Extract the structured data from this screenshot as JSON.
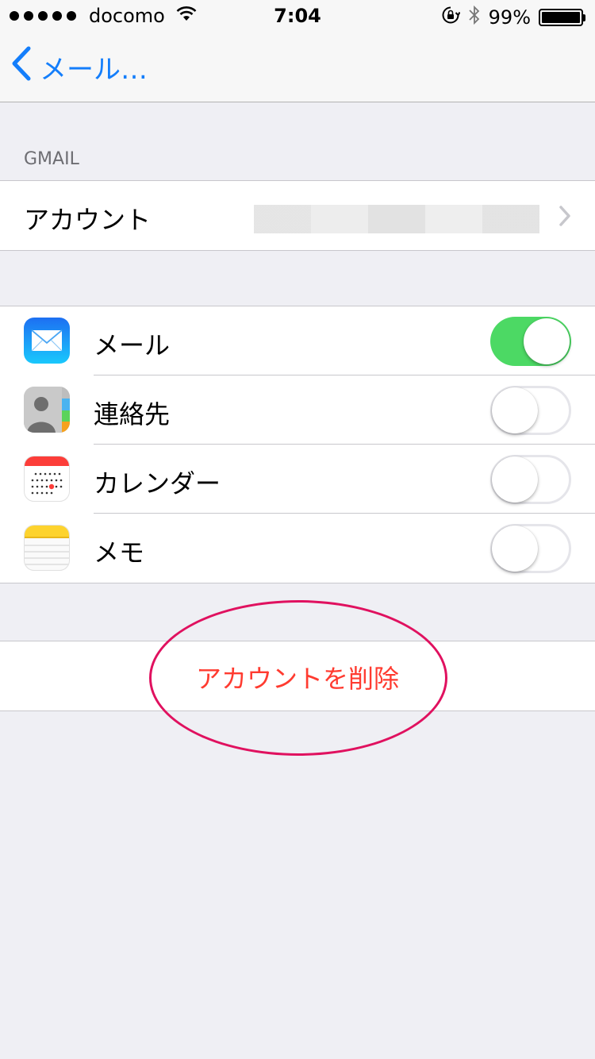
{
  "status_bar": {
    "carrier": "docomo",
    "time": "7:04",
    "battery": "99%",
    "signal_bars": 5,
    "icons": [
      "wifi-icon",
      "rotation-lock-icon",
      "bluetooth-icon",
      "battery-icon"
    ]
  },
  "nav": {
    "back_label": "メール…"
  },
  "account_section": {
    "header": "GMAIL",
    "account_label": "アカウント"
  },
  "services": [
    {
      "label": "メール",
      "icon": "mail-app-icon",
      "enabled": true
    },
    {
      "label": "連絡先",
      "icon": "contacts-app-icon",
      "enabled": false
    },
    {
      "label": "カレンダー",
      "icon": "calendar-app-icon",
      "enabled": false
    },
    {
      "label": "メモ",
      "icon": "notes-app-icon",
      "enabled": false
    }
  ],
  "delete_account_label": "アカウントを削除",
  "colors": {
    "accent": "#147efb",
    "toggle_on": "#4cd964",
    "destructive": "#ff3b30",
    "annotation": "#e0115f"
  }
}
